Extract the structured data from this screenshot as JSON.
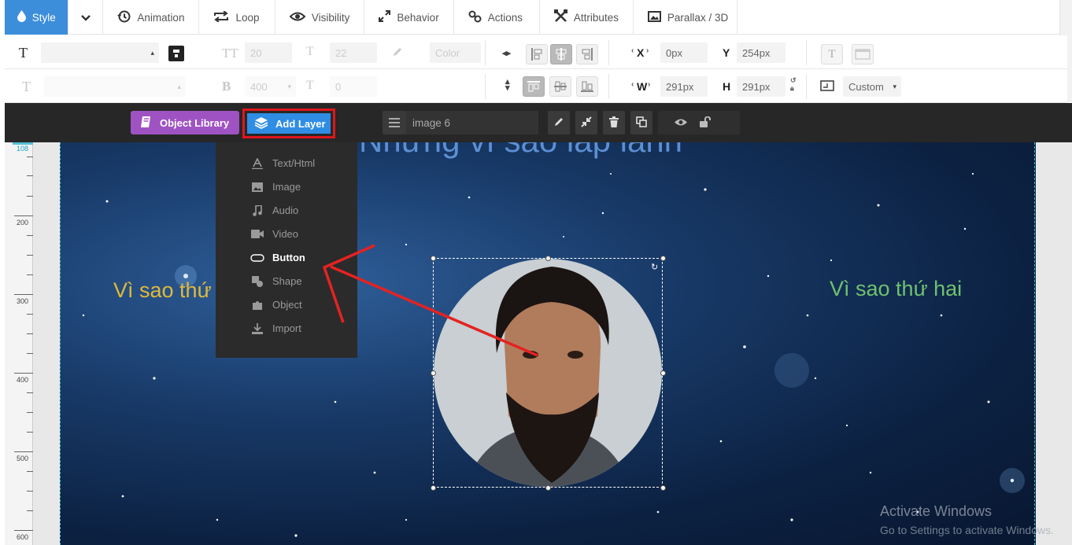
{
  "tabs": [
    {
      "label": "Style",
      "icon": "droplet-icon",
      "active": true
    },
    {
      "label": "Animation",
      "icon": "history-icon"
    },
    {
      "label": "Loop",
      "icon": "loop-icon"
    },
    {
      "label": "Visibility",
      "icon": "eye-icon"
    },
    {
      "label": "Behavior",
      "icon": "arrows-icon"
    },
    {
      "label": "Actions",
      "icon": "link-icon"
    },
    {
      "label": "Attributes",
      "icon": "wrench-icon"
    },
    {
      "label": "Parallax / 3D",
      "icon": "image-icon"
    }
  ],
  "toolbar": {
    "font_size": "20",
    "line_height": "22",
    "color_placeholder": "Color",
    "font_weight": "400",
    "letter_spacing": "0",
    "x_label": "X",
    "x_value": "0px",
    "y_label": "Y",
    "y_value": "254px",
    "w_label": "W",
    "w_value": "291px",
    "h_label": "H",
    "h_value": "291px",
    "scale_mode": "Custom"
  },
  "layerbar": {
    "object_library": "Object Library",
    "add_layer": "Add Layer",
    "layer_name": "image 6"
  },
  "add_layer_menu": [
    {
      "label": "Text/Html",
      "icon": "text-icon"
    },
    {
      "label": "Image",
      "icon": "image-icon"
    },
    {
      "label": "Audio",
      "icon": "music-icon"
    },
    {
      "label": "Video",
      "icon": "video-icon"
    },
    {
      "label": "Button",
      "icon": "button-icon",
      "highlighted": true
    },
    {
      "label": "Shape",
      "icon": "shape-icon"
    },
    {
      "label": "Object",
      "icon": "puzzle-icon"
    },
    {
      "label": "Import",
      "icon": "download-icon"
    }
  ],
  "ruler": {
    "highlight": "108",
    "marks": [
      "200",
      "300",
      "400",
      "500",
      "600"
    ]
  },
  "slide": {
    "title": "Những vì sao lấp lánh",
    "text_left": "Vì sao thứ",
    "text_right": "Vì sao thứ hai"
  },
  "watermark": {
    "line1": "Activate Windows",
    "line2": "Go to Settings to activate Windows."
  },
  "colors": {
    "accent": "#3c8edb",
    "library": "#9f53c2",
    "add_layer": "#2f8de4",
    "highlight_frame": "#e0161c",
    "arrow": "#e52222",
    "text_left": "#e0b93a",
    "text_right": "#6fc26f"
  }
}
